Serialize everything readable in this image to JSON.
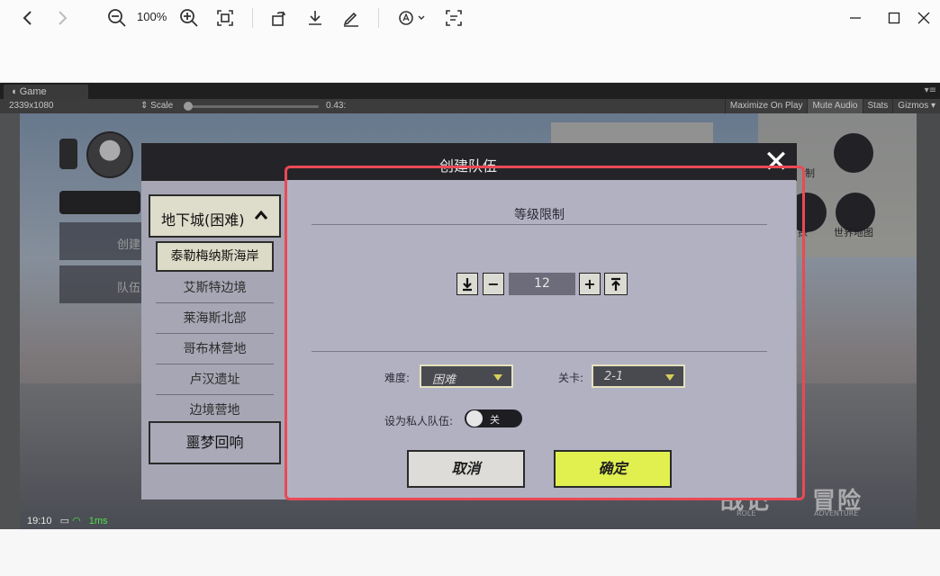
{
  "toolbar": {
    "zoom": "100%"
  },
  "game_window": {
    "tab": "Game",
    "resolution": "2339x1080",
    "scale_label": "Scale",
    "scale_value": "0.43:",
    "controls": [
      "Maximize On Play",
      "Mute Audio",
      "Stats",
      "Gizmos ▾"
    ]
  },
  "hud": {
    "left_items": [
      "创建",
      "队伍"
    ],
    "status_time": "19:10",
    "status_ping": "1ms",
    "right_labels": [
      "制",
      "探",
      "世界地图"
    ],
    "brand_left": "战记",
    "brand_right": "冒险",
    "brand_sub_left": "ROLE",
    "brand_sub_right": "ADVENTURE"
  },
  "dialog": {
    "title": "创建队伍",
    "category": "地下城(困难)",
    "sub_items": [
      "泰勒梅纳斯海岸",
      "艾斯特边境",
      "莱海斯北部",
      "哥布林营地",
      "卢汉遗址",
      "边境营地"
    ],
    "category2": "噩梦回响",
    "level_section_title": "等级限制",
    "level_value": "12",
    "difficulty_label": "难度:",
    "difficulty_value": "困难",
    "stage_label": "关卡:",
    "stage_value": "2-1",
    "private_label": "设为私人队伍:",
    "toggle_text": "关",
    "cancel": "取消",
    "confirm": "确定"
  },
  "colors": {
    "highlight": "#e94a55",
    "confirm_button": "#e1f04f"
  }
}
